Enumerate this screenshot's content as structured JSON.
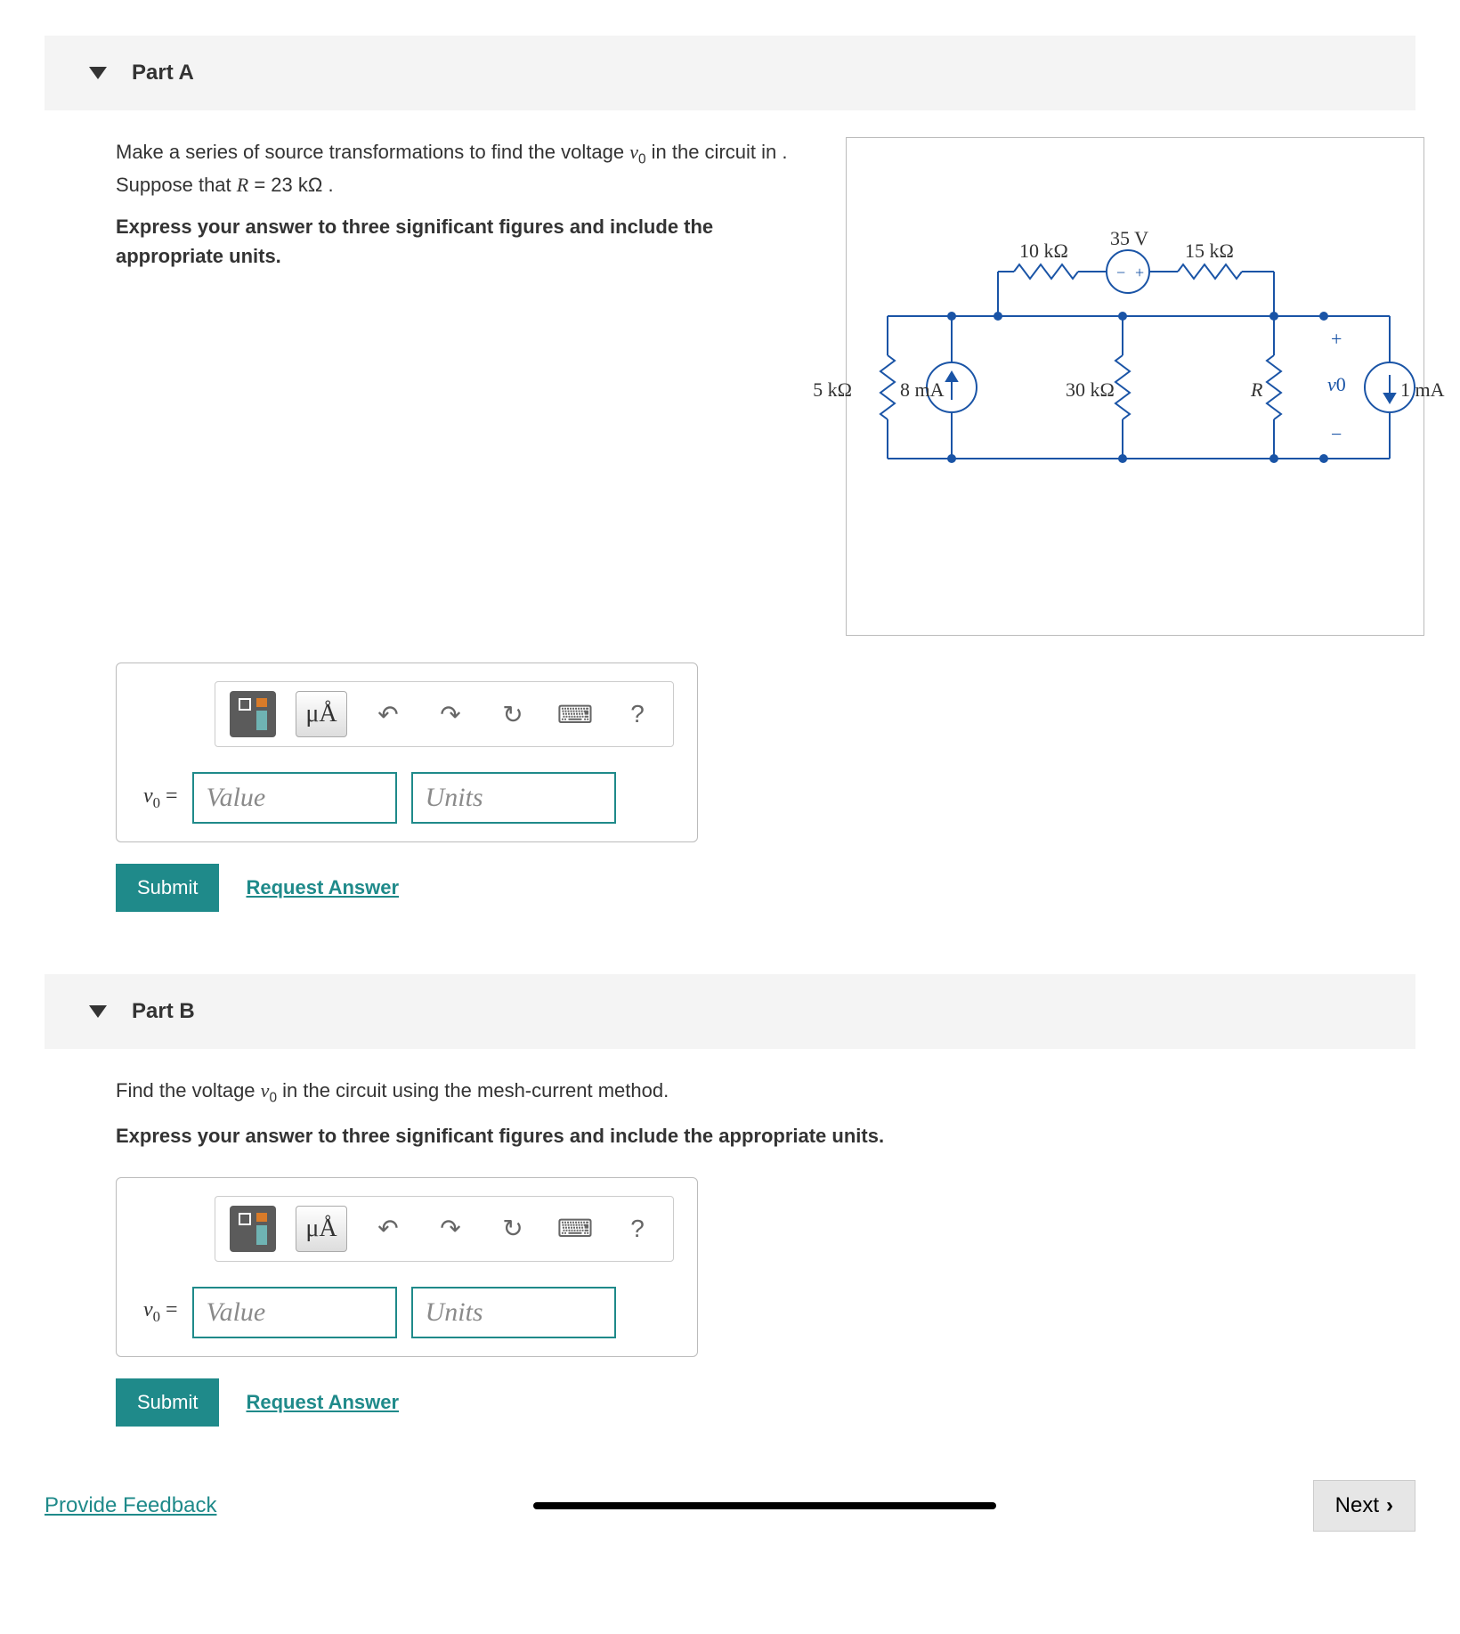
{
  "partA": {
    "title": "Part A",
    "prompt": {
      "prefix": "Make a series of source transformations to find the voltage ",
      "var": "v",
      "varSub": "0",
      "mid": " in the circuit in . Suppose that ",
      "rVar": "R",
      "eq": " = 23  kΩ ."
    },
    "instruction": "Express your answer to three significant figures and include the appropriate units.",
    "toolbar": {
      "units": "μÅ",
      "help": "?"
    },
    "answer": {
      "labelVar": "v",
      "labelSub": "0",
      "labelEq": " =",
      "valuePlaceholder": "Value",
      "unitsPlaceholder": "Units"
    },
    "submit": "Submit",
    "requestAnswer": "Request Answer"
  },
  "circuit": {
    "labels": {
      "r5k": "5 kΩ",
      "i8ma": "8 mA",
      "r10k": "10 kΩ",
      "v35": "35 V",
      "r30k": "30 kΩ",
      "r15k": "15 kΩ",
      "rR": "R",
      "vo": "v",
      "voSub": "0",
      "i1ma": "1 mA",
      "plus": "+",
      "minus": "−",
      "srcMinus": "−",
      "srcPlus": "+"
    }
  },
  "partB": {
    "title": "Part B",
    "prompt": {
      "prefix": "Find the voltage ",
      "var": "v",
      "varSub": "0",
      "suffix": " in the circuit using the mesh-current method."
    },
    "instruction": "Express your answer to three significant figures and include the appropriate units.",
    "toolbar": {
      "units": "μÅ",
      "help": "?"
    },
    "answer": {
      "labelVar": "v",
      "labelSub": "0",
      "labelEq": " =",
      "valuePlaceholder": "Value",
      "unitsPlaceholder": "Units"
    },
    "submit": "Submit",
    "requestAnswer": "Request Answer"
  },
  "footer": {
    "provideFeedback": "Provide Feedback",
    "next": "Next"
  }
}
